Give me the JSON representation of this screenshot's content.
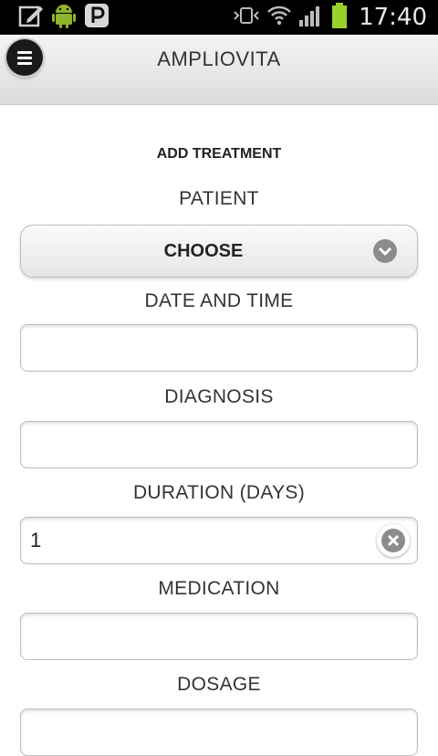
{
  "status_bar": {
    "time": "17:40",
    "left_icons": [
      "edit-icon",
      "android-icon",
      "pinterest-icon"
    ],
    "right_icons": [
      "vibrate-icon",
      "wifi-icon",
      "signal-icon",
      "battery-icon"
    ],
    "battery_color": "#9ad12f"
  },
  "header": {
    "title": "AMPLIOVITA",
    "menu_icon": "menu-icon"
  },
  "form": {
    "title": "ADD TREATMENT",
    "patient": {
      "label": "PATIENT",
      "value": "CHOOSE"
    },
    "datetime": {
      "label": "DATE AND TIME",
      "value": ""
    },
    "diagnosis": {
      "label": "DIAGNOSIS",
      "value": ""
    },
    "duration": {
      "label": "DURATION (DAYS)",
      "value": "1"
    },
    "medication": {
      "label": "MEDICATION",
      "value": ""
    },
    "dosage": {
      "label": "DOSAGE",
      "value": ""
    }
  }
}
